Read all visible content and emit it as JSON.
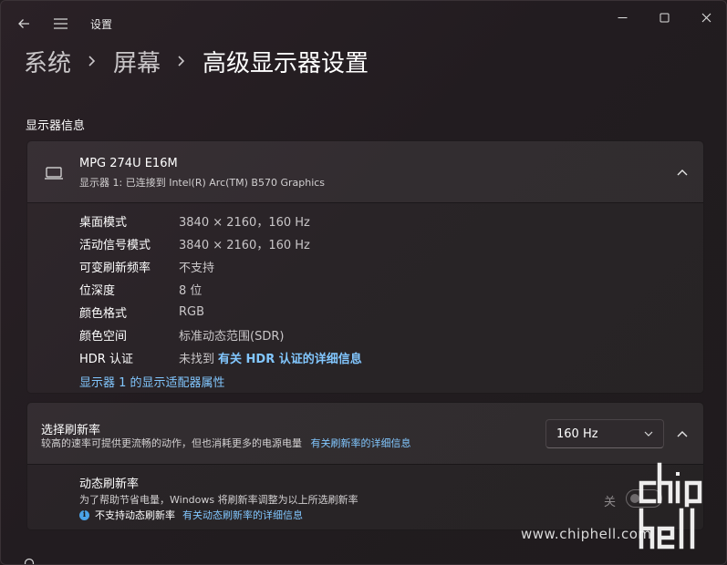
{
  "window": {
    "app_title": "设置"
  },
  "breadcrumb": {
    "items": [
      "系统",
      "屏幕"
    ],
    "current": "高级显示器设置"
  },
  "section": {
    "title": "显示器信息"
  },
  "monitor": {
    "name": "MPG 274U E16M",
    "subtitle": "显示器 1: 已连接到 Intel(R) Arc(TM) B570 Graphics",
    "rows": [
      {
        "label": "桌面模式",
        "value": "3840 × 2160，160 Hz"
      },
      {
        "label": "活动信号模式",
        "value": "3840 × 2160，160 Hz"
      },
      {
        "label": "可变刷新频率",
        "value": "不支持"
      },
      {
        "label": "位深度",
        "value": "8 位"
      },
      {
        "label": "颜色格式",
        "value": "RGB"
      },
      {
        "label": "颜色空间",
        "value": "标准动态范围(SDR)"
      }
    ],
    "hdr": {
      "label": "HDR 认证",
      "value": "未找到",
      "link": "有关 HDR 认证的详细信息"
    },
    "adapter_link": "显示器 1 的显示适配器属性"
  },
  "refresh": {
    "title": "选择刷新率",
    "description": "较高的速率可提供更流畅的动作，但也消耗更多的电源电量",
    "link": "有关刷新率的详细信息",
    "selected": "160 Hz",
    "dynamic": {
      "title": "动态刷新率",
      "description": "为了帮助节省电量，Windows 将刷新率调整为以上所选刷新率",
      "warning": "不支持动态刷新率",
      "warning_link": "有关动态刷新率的详细信息",
      "toggle_label": "关",
      "toggle_on": false
    }
  },
  "watermark": {
    "url": "www.chiphell.com"
  },
  "colors": {
    "accent_link": "#82c7ff",
    "info_icon": "#4aa3e8"
  }
}
